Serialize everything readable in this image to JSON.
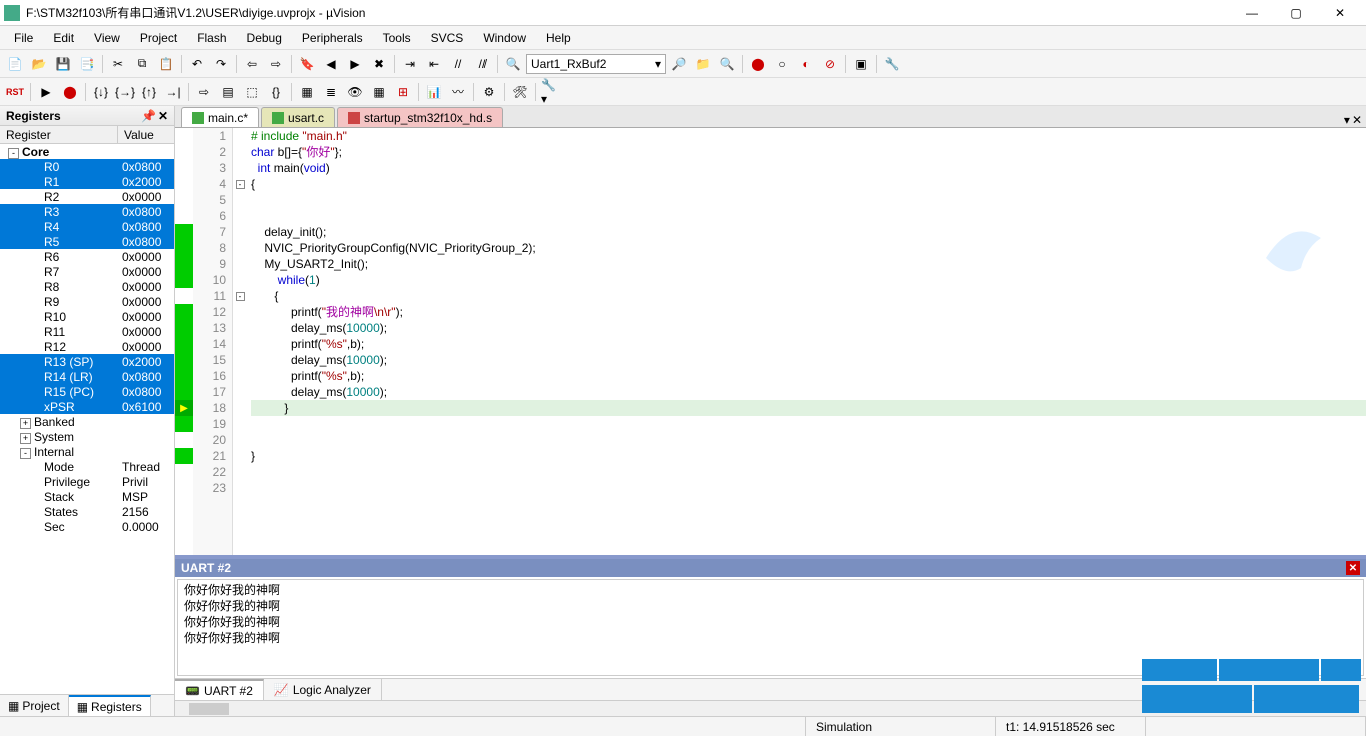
{
  "title": "F:\\STM32f103\\所有串口通讯V1.2\\USER\\diyige.uvprojx - µVision",
  "menus": [
    "File",
    "Edit",
    "View",
    "Project",
    "Flash",
    "Debug",
    "Peripherals",
    "Tools",
    "SVCS",
    "Window",
    "Help"
  ],
  "toolbar_combo": "Uart1_RxBuf2",
  "registers_panel": {
    "title": "Registers",
    "col1": "Register",
    "col2": "Value",
    "core_label": "Core",
    "rows": [
      {
        "name": "R0",
        "val": "0x0800",
        "sel": true
      },
      {
        "name": "R1",
        "val": "0x2000",
        "sel": true
      },
      {
        "name": "R2",
        "val": "0x0000",
        "sel": false
      },
      {
        "name": "R3",
        "val": "0x0800",
        "sel": true
      },
      {
        "name": "R4",
        "val": "0x0800",
        "sel": true
      },
      {
        "name": "R5",
        "val": "0x0800",
        "sel": true
      },
      {
        "name": "R6",
        "val": "0x0000",
        "sel": false
      },
      {
        "name": "R7",
        "val": "0x0000",
        "sel": false
      },
      {
        "name": "R8",
        "val": "0x0000",
        "sel": false
      },
      {
        "name": "R9",
        "val": "0x0000",
        "sel": false
      },
      {
        "name": "R10",
        "val": "0x0000",
        "sel": false
      },
      {
        "name": "R11",
        "val": "0x0000",
        "sel": false
      },
      {
        "name": "R12",
        "val": "0x0000",
        "sel": false
      },
      {
        "name": "R13 (SP)",
        "val": "0x2000",
        "sel": true
      },
      {
        "name": "R14 (LR)",
        "val": "0x0800",
        "sel": true
      },
      {
        "name": "R15 (PC)",
        "val": "0x0800",
        "sel": true
      },
      {
        "name": "xPSR",
        "val": "0x6100",
        "sel": true
      }
    ],
    "extra": [
      {
        "name": "Banked",
        "expand": "+"
      },
      {
        "name": "System",
        "expand": "+"
      },
      {
        "name": "Internal",
        "expand": "-"
      }
    ],
    "internal": [
      {
        "name": "Mode",
        "val": "Thread"
      },
      {
        "name": "Privilege",
        "val": "Privil"
      },
      {
        "name": "Stack",
        "val": "MSP"
      },
      {
        "name": "States",
        "val": "2156"
      },
      {
        "name": "Sec",
        "val": "0.0000"
      }
    ]
  },
  "left_tabs": [
    "Project",
    "Registers"
  ],
  "editor_tabs": [
    {
      "label": "main.c*",
      "active": true,
      "kind": "c"
    },
    {
      "label": "usart.c",
      "active": false,
      "kind": "c"
    },
    {
      "label": "startup_stm32f10x_hd.s",
      "active": false,
      "kind": "s"
    }
  ],
  "code_lines": [
    {
      "n": 1,
      "mark": "",
      "fold": "",
      "html": "<span class='pp'># include</span> <span class='str'>\"main.h\"</span>"
    },
    {
      "n": 2,
      "mark": "",
      "fold": "",
      "html": "<span class='kw'>char</span> b[]={<span class='str'>\"<span class='cn'>你好</span>\"</span>};"
    },
    {
      "n": 3,
      "mark": "",
      "fold": "",
      "html": "  <span class='kw'>int</span> main(<span class='kw'>void</span>)"
    },
    {
      "n": 4,
      "mark": "",
      "fold": "-",
      "html": "{"
    },
    {
      "n": 5,
      "mark": "",
      "fold": "",
      "html": ""
    },
    {
      "n": 6,
      "mark": "",
      "fold": "",
      "html": ""
    },
    {
      "n": 7,
      "mark": "green",
      "fold": "",
      "html": "    delay_init();"
    },
    {
      "n": 8,
      "mark": "green",
      "fold": "",
      "html": "    NVIC_PriorityGroupConfig(NVIC_PriorityGroup_2);"
    },
    {
      "n": 9,
      "mark": "green",
      "fold": "",
      "html": "    My_USART2_Init();"
    },
    {
      "n": 10,
      "mark": "green",
      "fold": "",
      "html": "        <span class='kw'>while</span>(<span class='num'>1</span>)"
    },
    {
      "n": 11,
      "mark": "",
      "fold": "-",
      "html": "       {"
    },
    {
      "n": 12,
      "mark": "green",
      "fold": "",
      "html": "            printf(<span class='str'>\"<span class='cn'>我的神啊</span>\\n\\r\"</span>);"
    },
    {
      "n": 13,
      "mark": "green",
      "fold": "",
      "html": "            delay_ms(<span class='num'>10000</span>);"
    },
    {
      "n": 14,
      "mark": "green",
      "fold": "",
      "html": "            printf(<span class='str'>\"%s\"</span>,b);"
    },
    {
      "n": 15,
      "mark": "green",
      "fold": "",
      "html": "            delay_ms(<span class='num'>10000</span>);"
    },
    {
      "n": 16,
      "mark": "green",
      "fold": "",
      "html": "            printf(<span class='str'>\"%s\"</span>,b);"
    },
    {
      "n": 17,
      "mark": "green",
      "fold": "",
      "html": "            delay_ms(<span class='num'>10000</span>);"
    },
    {
      "n": 18,
      "mark": "arrow",
      "fold": "",
      "html": "          }",
      "current": true
    },
    {
      "n": 19,
      "mark": "green",
      "fold": "",
      "html": ""
    },
    {
      "n": 20,
      "mark": "",
      "fold": "",
      "html": ""
    },
    {
      "n": 21,
      "mark": "green",
      "fold": "",
      "html": "}"
    },
    {
      "n": 22,
      "mark": "",
      "fold": "",
      "html": ""
    },
    {
      "n": 23,
      "mark": "",
      "fold": "",
      "html": ""
    }
  ],
  "uart": {
    "title": "UART #2",
    "lines": [
      "你好你好我的神啊",
      "你好你好我的神啊",
      "你好你好我的神啊",
      "你好你好我的神啊"
    ],
    "tabs": [
      "UART #2",
      "Logic Analyzer"
    ]
  },
  "status": {
    "sim": "Simulation",
    "time": "t1: 14.91518526 sec"
  }
}
